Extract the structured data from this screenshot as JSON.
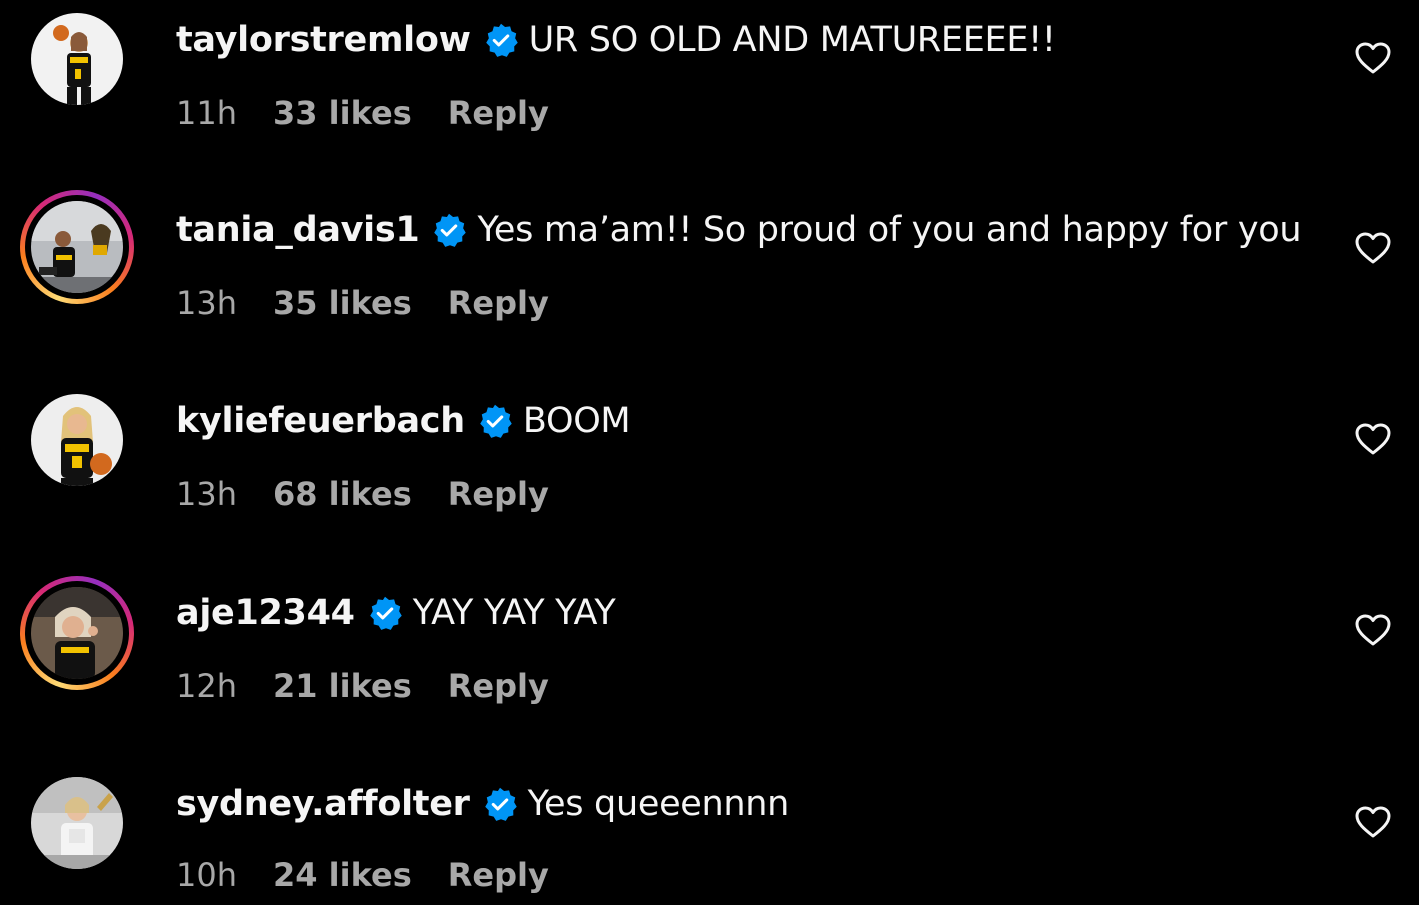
{
  "colors": {
    "background": "#000000",
    "text_primary": "#f5f5f5",
    "text_secondary": "#a8a8a8",
    "verified_badge": "#0095f6"
  },
  "icons": {
    "verified": "verified-badge-icon",
    "like": "heart-outline-icon"
  },
  "comments": [
    {
      "username": "taylorstremlow",
      "text": "UR SO OLD AND MATUREEEE!!",
      "time": "11h",
      "likes": "33 likes",
      "reply": "Reply",
      "story_ring": false
    },
    {
      "username": "tania_davis1",
      "text": "Yes ma’am!! So proud of you and happy for you",
      "time": "13h",
      "likes": "35 likes",
      "reply": "Reply",
      "story_ring": true
    },
    {
      "username": "kyliefeuerbach",
      "text": "BOOM",
      "time": "13h",
      "likes": "68 likes",
      "reply": "Reply",
      "story_ring": false
    },
    {
      "username": "aje12344",
      "text": "YAY YAY YAY",
      "time": "12h",
      "likes": "21 likes",
      "reply": "Reply",
      "story_ring": true
    },
    {
      "username": "sydney.affolter",
      "text": "Yes queeennnn",
      "time": "10h",
      "likes": "24 likes",
      "reply": "Reply",
      "story_ring": false
    }
  ]
}
